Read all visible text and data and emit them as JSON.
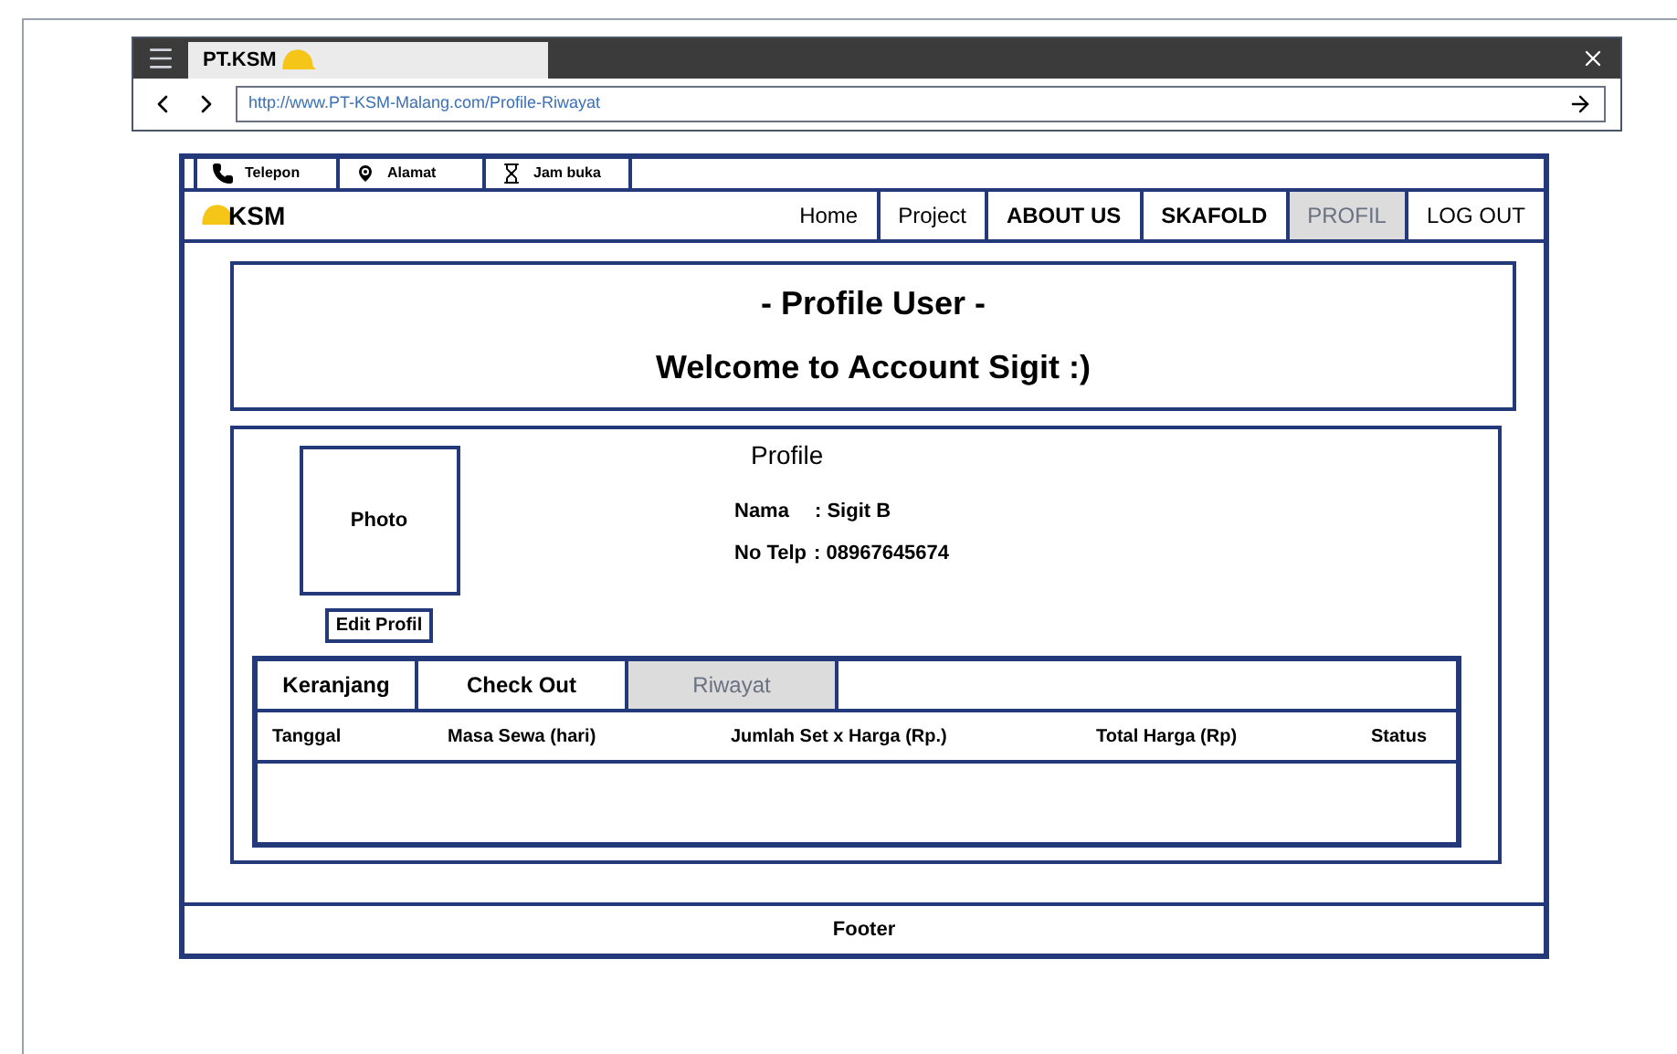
{
  "browser": {
    "tab_title": "PT.KSM",
    "url": "http://www.PT-KSM-Malang.com/Profile-Riwayat"
  },
  "info_bar": [
    {
      "kind": "phone",
      "label": "Telepon"
    },
    {
      "kind": "pin",
      "label": "Alamat"
    },
    {
      "kind": "hourglass",
      "label": "Jam buka"
    }
  ],
  "logo": "KSM",
  "nav": [
    {
      "label": "Home",
      "selected": false
    },
    {
      "label": "Project",
      "selected": false
    },
    {
      "label": "ABOUT US",
      "selected": false
    },
    {
      "label": "SKAFOLD",
      "selected": false
    },
    {
      "label": "PROFIL",
      "selected": true
    },
    {
      "label": "LOG OUT",
      "selected": false
    }
  ],
  "header": {
    "title": "- Profile User -",
    "subtitle": "Welcome to Account Sigit :)"
  },
  "profile": {
    "heading": "Profile",
    "photo": "Photo",
    "edit_button": "Edit Profil",
    "name_label": "Nama",
    "name_value": ": Sigit B",
    "phone_label": "No Telp",
    "phone_value": ": 08967645674"
  },
  "tabs": [
    {
      "label": "Keranjang",
      "selected": false
    },
    {
      "label": "Check Out",
      "selected": false
    },
    {
      "label": "Riwayat",
      "selected": true
    }
  ],
  "table": {
    "columns": [
      "Tanggal",
      "Masa Sewa (hari)",
      "Jumlah Set x Harga (Rp.)",
      "Total Harga (Rp)",
      "Status"
    ]
  },
  "footer": "Footer"
}
